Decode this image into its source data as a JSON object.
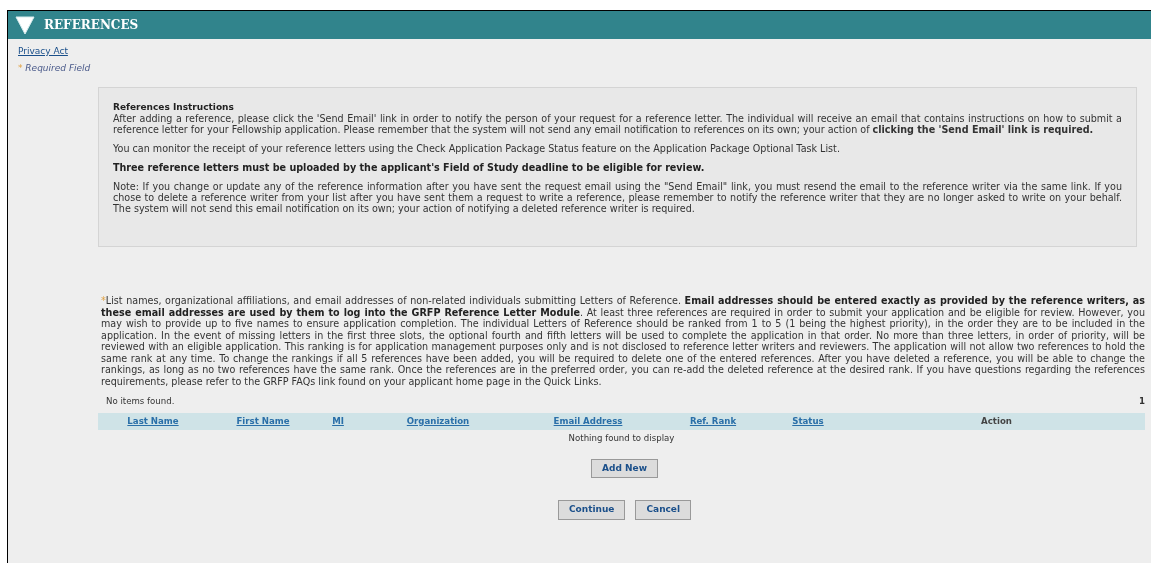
{
  "header": {
    "title": "REFERENCES"
  },
  "privacy_link": "Privacy Act",
  "required_note": {
    "mark": "*",
    "text": "Required Field"
  },
  "instructions": {
    "title": "References Instructions",
    "paragraphs": [
      {
        "text": "After adding a reference, please click the 'Send Email' link in order to notify the person of your request for a reference letter. The individual will receive an email that contains instructions on how to submit a reference letter for your Fellowship application. Please remember that the system will not send any email notification to references on its own; your action of **clicking the 'Send Email' link is required.**",
        "bold": false
      },
      {
        "text": "You can monitor the receipt of your reference letters using the Check Application Package Status feature on the Application Package Optional Task List.",
        "bold": false
      },
      {
        "text": "Three reference letters must be uploaded by the applicant's Field of Study deadline to be eligible for review.",
        "bold": true
      },
      {
        "text": "Note: If you change or update any of the reference information after you have sent the request email using the \"Send Email\" link, you must resend the email to the reference writer via the same link. If you chose to delete a reference writer from your list after you have sent them a request to write a reference, please remember to notify the reference writer that they are no longer asked to write on your behalf. The system will not send this email notification on its own; your action of notifying a deleted reference writer is required.",
        "bold": false
      }
    ]
  },
  "list_note": {
    "mark": "*",
    "text": "List names, organizational affiliations, and email addresses of non-related individuals submitting Letters of Reference. **Email addresses should be entered exactly as provided by the reference writers, as these email addresses are used by them to log into the GRFP Reference Letter Module**. At least three references are required in order to submit your application and be eligible for review. However, you may wish to provide up to five names to ensure application completion. The individual Letters of Reference should be ranked from 1 to 5 (1 being the highest priority), in the order they are to be included in the application. In the event of missing letters in the first three slots, the optional fourth and fifth letters will be used to complete the application in that order. No more than three letters, in order of priority, will be reviewed with an eligible application. This ranking is for application management purposes only and is not disclosed to reference letter writers and reviewers. The application will not allow two references to hold the same rank at any time. To change the rankings if all 5 references have been added, you will be required to delete one of the entered references. After you have deleted a reference, you will be able to change the rankings, as long as no two references have the same rank. Once the references are in the preferred order, you can re-add the deleted reference at the desired rank. If you have questions regarding the references requirements, please refer to the GRFP FAQs link found on your applicant home page in the Quick Links."
  },
  "table": {
    "status": "No items found.",
    "page": "1",
    "columns": [
      {
        "label": "Last Name",
        "sortable": true
      },
      {
        "label": "First Name",
        "sortable": true
      },
      {
        "label": "MI",
        "sortable": true
      },
      {
        "label": "Organization",
        "sortable": true
      },
      {
        "label": "Email Address",
        "sortable": true
      },
      {
        "label": "Ref. Rank",
        "sortable": true
      },
      {
        "label": "Status",
        "sortable": true
      },
      {
        "label": "Action",
        "sortable": false
      }
    ],
    "empty_message": "Nothing found to display"
  },
  "add_button": "Add New",
  "buttons": [
    "Continue",
    "Cancel"
  ]
}
